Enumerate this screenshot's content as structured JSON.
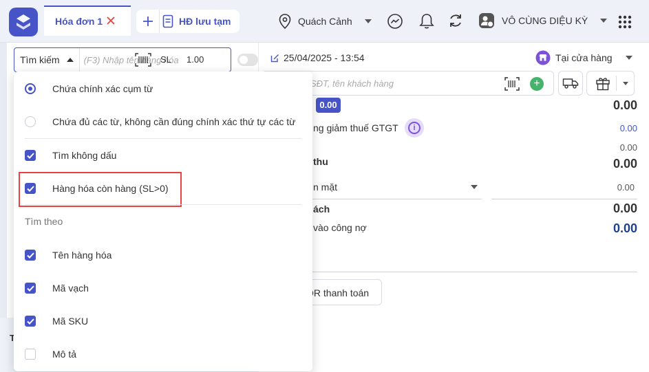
{
  "topbar": {
    "active_tab": "Hóa đơn 1",
    "saved_label": "HĐ lưu tạm",
    "location": "Quách Cảnh",
    "company": "VÔ CÙNG DIỆU KỲ",
    "accent": "#4654c8"
  },
  "search": {
    "mode": "Tìm kiếm",
    "placeholder": "(F3) Nhập tên hàng hóa",
    "qty_label": "SL",
    "qty_value": "1.00"
  },
  "dropdown": {
    "match_options": [
      {
        "label": "Chứa chính xác cụm từ",
        "selected": true
      },
      {
        "label": "Chứa đủ các từ, không cần đúng chính xác thứ tự các từ",
        "selected": false
      }
    ],
    "no_accent": {
      "label": "Tìm không dấu",
      "checked": true
    },
    "in_stock": {
      "label": "Hàng hóa còn hàng (SL>0)",
      "checked": true
    },
    "section_title": "Tìm theo",
    "fields": [
      {
        "label": "Tên hàng hóa",
        "checked": true
      },
      {
        "label": "Mã vạch",
        "checked": true
      },
      {
        "label": "Mã SKU",
        "checked": true
      },
      {
        "label": "Mô tả",
        "checked": false
      }
    ]
  },
  "left_bottom": {
    "label": "T"
  },
  "invoice": {
    "datetime": "25/04/2025 - 13:54",
    "channel": "Tại cửa hàng",
    "customer_placeholder": "SĐT, tên khách hàng",
    "pill": "0.00",
    "total": "0.00",
    "vat_label": "ng giảm thuế GTGT",
    "vat_value": "0.00",
    "extra_value": "0.00",
    "due_label": "thu",
    "due_value": "0.00",
    "method_label": "n mặt",
    "method_value": "0.00",
    "change_label": "ách",
    "change_value": "0.00",
    "debt_label": "vào công nợ",
    "debt_value": "0.00",
    "qr_label": "QR thanh toán"
  }
}
